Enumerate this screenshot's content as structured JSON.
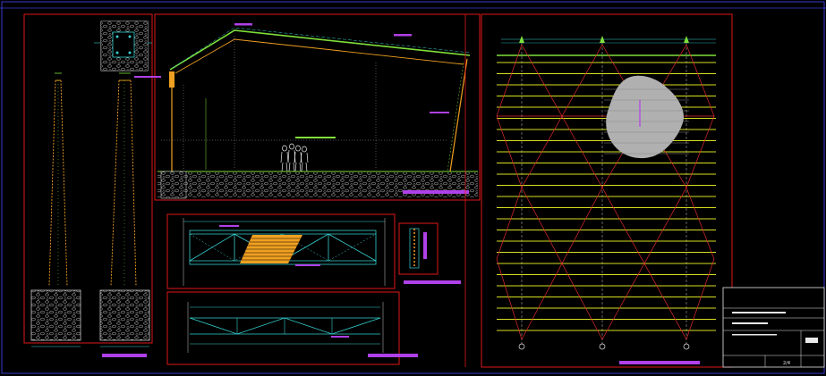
{
  "colors": {
    "background": "#000000",
    "frame_red": "#e01818",
    "frame_blue": "#3a3ad0",
    "steel_green": "#7fe03a",
    "purlin_yellow": "#d8e020",
    "bracing_red": "#e02a2a",
    "dim_cyan": "#37d0d0",
    "magenta_tag": "#b040e8",
    "orange_member": "#f0a020",
    "gravel_white": "#c8c8c8",
    "grey_fill": "#b0b0b0",
    "title_white": "#e8e8e8"
  },
  "title_block": {
    "sheet_number": "2/4"
  }
}
